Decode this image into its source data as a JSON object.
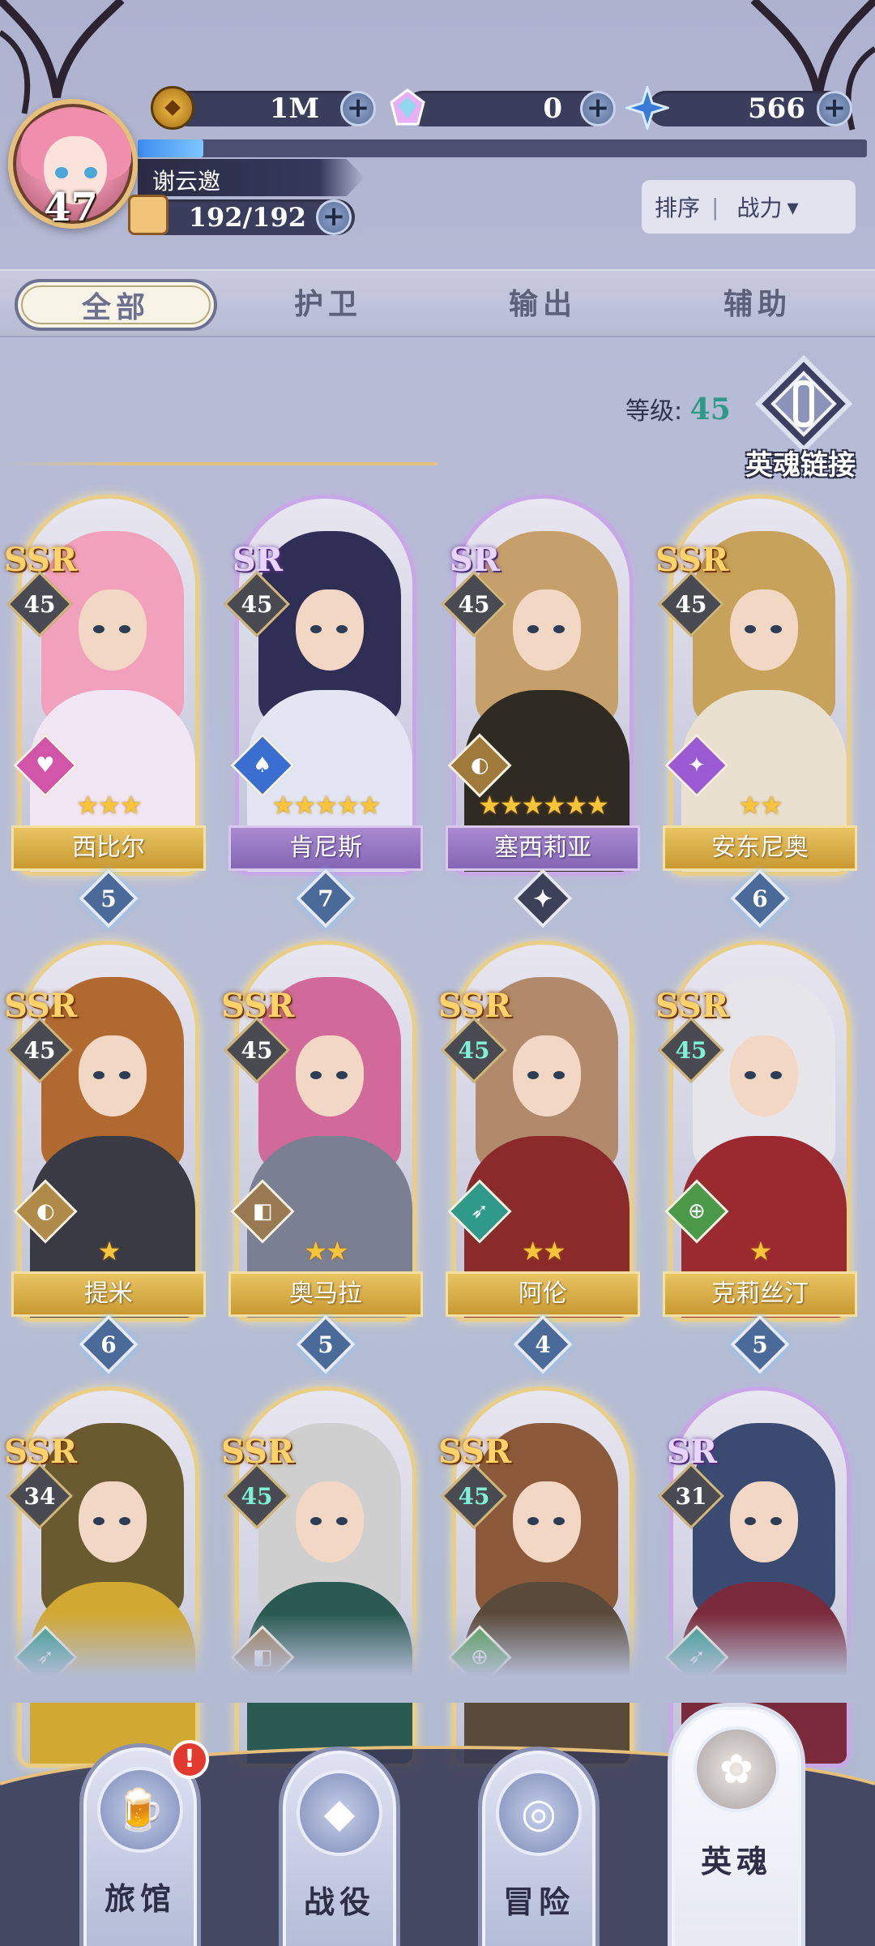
{
  "player": {
    "level": "47",
    "name": "谢云邀",
    "stamina": "192/192",
    "xp_fraction": 0.09
  },
  "resources": [
    {
      "name": "gold-coin",
      "value": "1M"
    },
    {
      "name": "gem",
      "value": "0"
    },
    {
      "name": "star-crystal",
      "value": "566"
    }
  ],
  "sort": {
    "label": "排序",
    "value": "战力"
  },
  "tabs": [
    {
      "label": "全部",
      "active": true
    },
    {
      "label": "护卫",
      "active": false
    },
    {
      "label": "输出",
      "active": false
    },
    {
      "label": "辅助",
      "active": false
    }
  ],
  "level_filter": {
    "label": "等级:",
    "value": "45"
  },
  "link_button": {
    "label": "英魂链接"
  },
  "heroes": [
    {
      "name": "西比尔",
      "rarity": "SSR",
      "level": "45",
      "stars": 3,
      "badge": "5",
      "role_icon": "heart-icon",
      "role_color": "#d155a8",
      "hair": "#f2a1bc",
      "body": "#f1e6f3"
    },
    {
      "name": "肯尼斯",
      "rarity": "SR",
      "level": "45",
      "stars": 5,
      "badge": "7",
      "role_icon": "hat-icon",
      "role_color": "#3a6fd1",
      "hair": "#2f2f55",
      "body": "#e3e6f2"
    },
    {
      "name": "塞西莉亚",
      "rarity": "SR",
      "level": "45",
      "stars": 6,
      "badge": "",
      "role_icon": "shield-icon",
      "role_color": "#a07a3a",
      "hair": "#c6a06a",
      "body": "#2f2a22"
    },
    {
      "name": "安东尼奥",
      "rarity": "SSR",
      "level": "45",
      "stars": 2,
      "badge": "6",
      "role_icon": "flame-icon",
      "role_color": "#9a5ad1",
      "hair": "#c7a25a",
      "body": "#e9e0cf"
    },
    {
      "name": "提米",
      "rarity": "SSR",
      "level": "45",
      "stars": 1,
      "badge": "6",
      "role_icon": "shield-icon",
      "role_color": "#b08a48",
      "hair": "#b06a30",
      "body": "#3a3a44"
    },
    {
      "name": "奥马拉",
      "rarity": "SSR",
      "level": "45",
      "stars": 2,
      "badge": "5",
      "role_icon": "blade-icon",
      "role_color": "#9a7a52",
      "hair": "#d16a9a",
      "body": "#7a7f92"
    },
    {
      "name": "阿伦",
      "rarity": "SSR",
      "level": "45",
      "stars": 2,
      "badge": "4",
      "role_icon": "bow-icon",
      "role_color": "#2f9a8a",
      "hair": "#b08a6a",
      "body": "#8a2a2a",
      "teal_level": true
    },
    {
      "name": "克莉丝汀",
      "rarity": "SSR",
      "level": "45",
      "stars": 1,
      "badge": "5",
      "role_icon": "target-icon",
      "role_color": "#4a9a4a",
      "hair": "#e6e6ea",
      "body": "#9a2a30",
      "teal_level": true
    },
    {
      "name": "",
      "rarity": "SSR",
      "level": "34",
      "stars": 0,
      "badge": "",
      "role_icon": "bow-icon",
      "role_color": "#2f9a8a",
      "hair": "#6a5a30",
      "body": "#d1a832"
    },
    {
      "name": "",
      "rarity": "SSR",
      "level": "45",
      "stars": 0,
      "badge": "",
      "role_icon": "blade-icon",
      "role_color": "#9a7a52",
      "hair": "#cfcfcf",
      "body": "#2a5a52",
      "teal_level": true
    },
    {
      "name": "",
      "rarity": "SSR",
      "level": "45",
      "stars": 0,
      "badge": "",
      "role_icon": "target-icon",
      "role_color": "#4a9a4a",
      "hair": "#8a5a3a",
      "body": "#5a4a3a",
      "teal_level": true
    },
    {
      "name": "",
      "rarity": "SR",
      "level": "31",
      "stars": 0,
      "badge": "",
      "role_icon": "bow-icon",
      "role_color": "#2f9a8a",
      "hair": "#3a4a70",
      "body": "#7a2a3a"
    }
  ],
  "nav": [
    {
      "label": "旅馆",
      "icon": "tavern-icon",
      "notification": "!"
    },
    {
      "label": "战役",
      "icon": "campaign-icon",
      "notification": ""
    },
    {
      "label": "冒险",
      "icon": "adventure-icon",
      "notification": ""
    },
    {
      "label": "英魂",
      "icon": "hero-soul-icon",
      "notification": "",
      "active": true
    }
  ]
}
